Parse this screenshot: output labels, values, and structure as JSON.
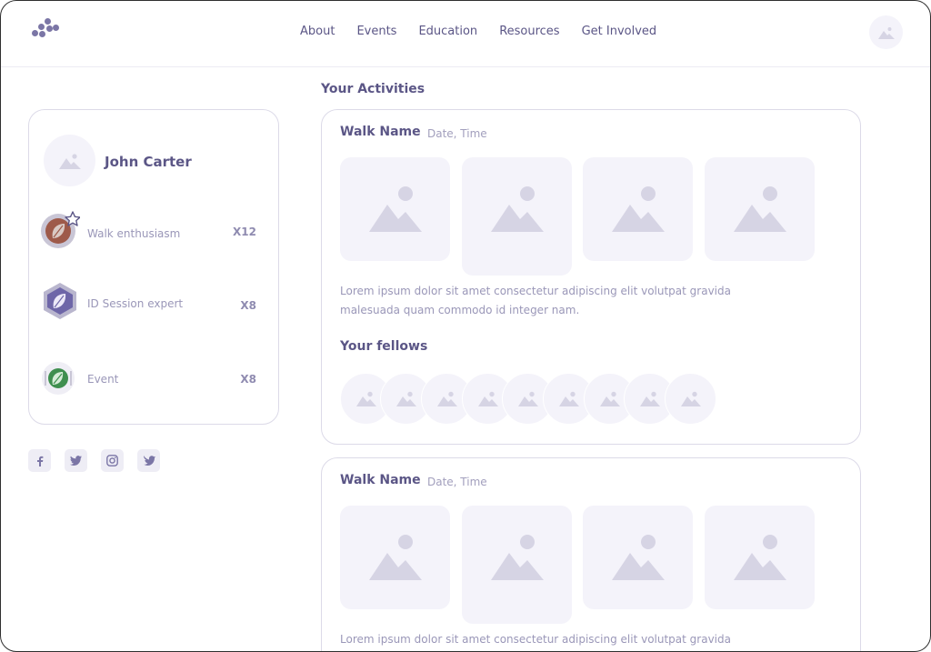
{
  "nav": [
    "About",
    "Events",
    "Education",
    "Resources",
    "Get Involved"
  ],
  "icons": {
    "logo": "dots-logo-icon",
    "avatar": "image-placeholder-icon",
    "photo": "image-placeholder-icon"
  },
  "colors": {
    "primary_text": "#5b5686",
    "muted_text": "#9a97b8",
    "placeholder_bg": "#f4f3fa",
    "placeholder_icon": "#d6d4e4",
    "border": "#dcdae8"
  },
  "profile": {
    "name": "John Carter",
    "badges": [
      {
        "label": "Walk enthusiasm",
        "count": "X12",
        "icon": "leaf-star-badge-icon"
      },
      {
        "label": "ID Session expert",
        "count": "X8",
        "icon": "hexagon-leaf-badge-icon"
      },
      {
        "label": "Event",
        "count": "X8",
        "icon": "green-leaf-badge-icon"
      }
    ]
  },
  "socials": [
    "facebook-icon",
    "twitter-icon",
    "instagram-icon",
    "bird-icon"
  ],
  "activities": {
    "title": "Your Activities",
    "cards": [
      {
        "walk_name": "Walk Name",
        "date_time": "Date, Time",
        "description_line1": "Lorem ipsum dolor sit amet consectetur adipiscing elit volutpat gravida",
        "description_line2": "malesuada quam commodo id integer nam.",
        "fellows_title": "Your fellows"
      },
      {
        "walk_name": "Walk Name",
        "date_time": "Date, Time",
        "description_line1": "Lorem ipsum dolor sit amet consectetur adipiscing elit volutpat gravida"
      }
    ]
  }
}
